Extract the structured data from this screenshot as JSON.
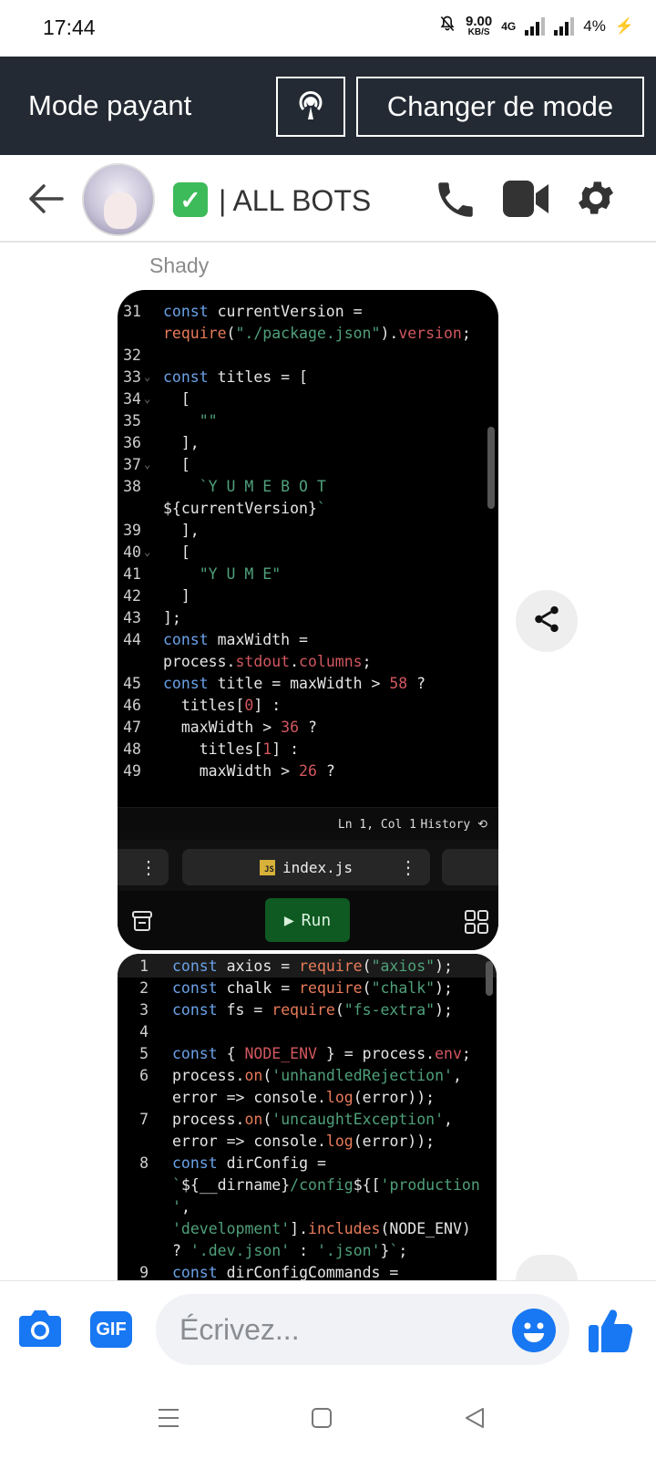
{
  "status_bar": {
    "time": "17:44",
    "speed_value": "9.00",
    "speed_unit": "KB/S",
    "network": "4G",
    "battery": "4%"
  },
  "mode_bar": {
    "title": "Mode payant",
    "change_button": "Changer de mode"
  },
  "chat_header": {
    "check_emoji": "✓",
    "title": "| ALL BOTS"
  },
  "message": {
    "sender": "Shady"
  },
  "code1": {
    "lines": [
      {
        "n": "31",
        "fold": "",
        "html": "<span class='kw'>const</span> currentVersion ="
      },
      {
        "n": "",
        "fold": "",
        "html": "<span class='fn'>require</span>(<span class='st'>\"./package.json\"</span>).<span class='pr'>version</span>;"
      },
      {
        "n": "32",
        "fold": "",
        "html": ""
      },
      {
        "n": "33",
        "fold": "⌄",
        "html": "<span class='kw'>const</span> titles = ["
      },
      {
        "n": "34",
        "fold": "⌄",
        "html": "  ["
      },
      {
        "n": "35",
        "fold": "",
        "html": "    <span class='st'>\"\"</span>"
      },
      {
        "n": "36",
        "fold": "",
        "html": "  ],"
      },
      {
        "n": "37",
        "fold": "⌄",
        "html": "  ["
      },
      {
        "n": "38",
        "fold": "",
        "html": "    <span class='st'>`Y U M E B O T</span>"
      },
      {
        "n": "",
        "fold": "",
        "html": "${currentVersion}<span class='st'>`</span>"
      },
      {
        "n": "39",
        "fold": "",
        "html": "  ],"
      },
      {
        "n": "40",
        "fold": "⌄",
        "html": "  ["
      },
      {
        "n": "41",
        "fold": "",
        "html": "    <span class='st'>\"Y U M E\"</span>"
      },
      {
        "n": "42",
        "fold": "",
        "html": "  ]"
      },
      {
        "n": "43",
        "fold": "",
        "html": "];"
      },
      {
        "n": "44",
        "fold": "",
        "html": "<span class='kw'>const</span> maxWidth ="
      },
      {
        "n": "",
        "fold": "",
        "html": "process.<span class='pr'>stdout</span>.<span class='pr'>columns</span>;"
      },
      {
        "n": "45",
        "fold": "",
        "html": "<span class='kw'>const</span> title = maxWidth &gt; <span class='nm'>58</span> ?"
      },
      {
        "n": "46",
        "fold": "",
        "html": "  titles[<span class='nm'>0</span>] :"
      },
      {
        "n": "47",
        "fold": "",
        "html": "  maxWidth &gt; <span class='nm'>36</span> ?"
      },
      {
        "n": "48",
        "fold": "",
        "html": "    titles[<span class='nm'>1</span>] :"
      },
      {
        "n": "49",
        "fold": "",
        "html": "    maxWidth &gt; <span class='nm'>26</span> ?"
      }
    ],
    "cursor_position": "Ln 1, Col 1",
    "history_label": "History",
    "tab_file": "index.js",
    "js_badge": "JS",
    "run_label": "Run"
  },
  "code2": {
    "lines": [
      {
        "n": "1",
        "html": "<span class='kw'>const</span> axios = <span class='fn'>require</span>(<span class='st'>\"axios\"</span>);"
      },
      {
        "n": "2",
        "html": "<span class='kw'>const</span> chalk = <span class='fn'>require</span>(<span class='st'>\"chalk\"</span>);"
      },
      {
        "n": "3",
        "html": "<span class='kw'>const</span> fs = <span class='fn'>require</span>(<span class='st'>\"fs-extra\"</span>);"
      },
      {
        "n": "4",
        "html": ""
      },
      {
        "n": "5",
        "html": "<span class='kw'>const</span> { <span class='pr'>NODE_ENV</span> } = process.<span class='pr'>env</span>;"
      },
      {
        "n": "6",
        "html": "process.<span class='fn'>on</span>(<span class='st'>'unhandledRejection'</span>,"
      },
      {
        "n": "",
        "html": "error =&gt; console.<span class='fn'>log</span>(error));"
      },
      {
        "n": "7",
        "html": "process.<span class='fn'>on</span>(<span class='st'>'uncaughtException'</span>,"
      },
      {
        "n": "",
        "html": "error =&gt; console.<span class='fn'>log</span>(error));"
      },
      {
        "n": "8",
        "html": "<span class='kw'>const</span> dirConfig ="
      },
      {
        "n": "",
        "html": "<span class='st'>`</span>${__dirname}<span class='st'>/config</span>${[<span class='st'>'production</span>"
      },
      {
        "n": "",
        "html": "<span class='st'>'</span>,"
      },
      {
        "n": "",
        "html": "<span class='st'>'development'</span>].<span class='fn'>includes</span>(NODE_ENV)"
      },
      {
        "n": "",
        "html": "? <span class='st'>'.dev.json'</span> : <span class='st'>'.json'</span>}<span class='st'>`</span>;"
      },
      {
        "n": "9",
        "html": "<span class='kw'>const</span> dirConfigCommands ="
      }
    ]
  },
  "composer": {
    "gif_label": "GIF",
    "placeholder": "Écrivez..."
  },
  "icons": [
    "broadcast-icon",
    "back-arrow-icon",
    "phone-icon",
    "video-icon",
    "gear-icon",
    "share-icon",
    "camera-icon",
    "emoji-icon",
    "thumbs-up-icon",
    "mute-icon"
  ],
  "colors": {
    "mode_bar_bg": "#232a33",
    "messenger_blue": "#1877f2",
    "run_green": "#0f5a22"
  }
}
